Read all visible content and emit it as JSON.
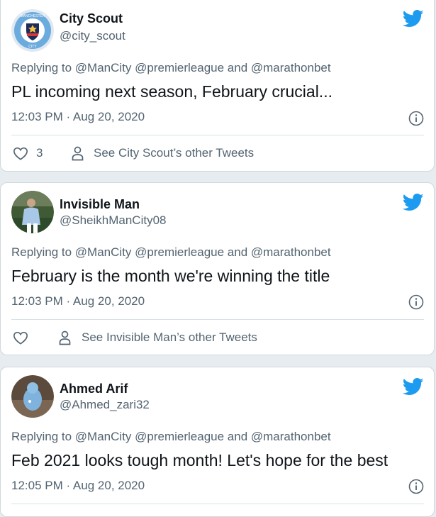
{
  "colors": {
    "twitter_blue": "#1d9bf0",
    "text_primary": "#0f1419",
    "text_secondary": "#536471",
    "background": "#e6ecf0"
  },
  "tweets": [
    {
      "author_name": "City Scout",
      "author_handle": "@city_scout",
      "avatar_icon": "manchester-city-crest",
      "reply_prefix": "Replying to",
      "reply_mentions": "@ManCity @premierleague and @marathonbet",
      "text": "PL incoming next season, February crucial...",
      "time": "12:03 PM · Aug 20, 2020",
      "likes": "3",
      "other_tweets_label": "See City Scout’s other Tweets"
    },
    {
      "author_name": "Invisible Man",
      "author_handle": "@SheikhManCity08",
      "avatar_icon": "footballer-photo",
      "reply_prefix": "Replying to",
      "reply_mentions": "@ManCity @premierleague and @marathonbet",
      "text": "February is the month we're winning the title",
      "time": "12:03 PM · Aug 20, 2020",
      "likes": "",
      "other_tweets_label": "See Invisible Man’s other Tweets"
    },
    {
      "author_name": "Ahmed Arif",
      "author_handle": "@Ahmed_zari32",
      "avatar_icon": "toy-figure-photo",
      "reply_prefix": "Replying to",
      "reply_mentions": "@ManCity @premierleague and @marathonbet",
      "text": "Feb 2021 looks tough month! Let's hope for the best",
      "time": "12:05 PM · Aug 20, 2020"
    }
  ]
}
